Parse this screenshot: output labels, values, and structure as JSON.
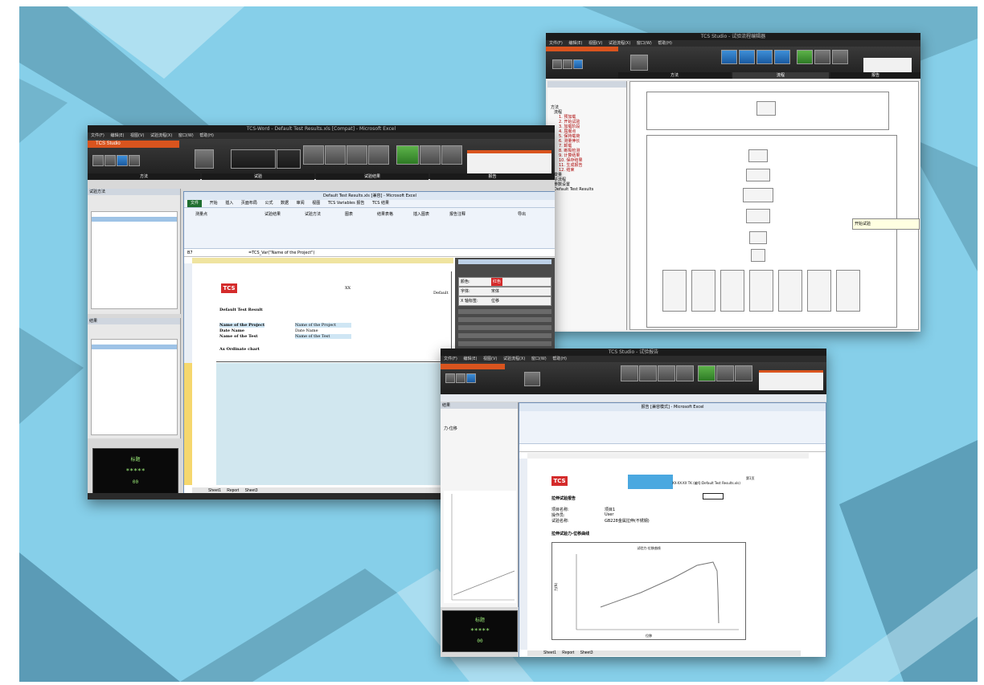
{
  "shot1": {
    "window_title": "TCS-Word - Default Test Results.xls [Compat] - Microsoft Excel",
    "menu": [
      "文件(F)",
      "编辑(E)",
      "视图(V)",
      "试验流程(X)",
      "窗口(W)",
      "帮助(H)"
    ],
    "app_label": "TCS Studio",
    "sections": [
      "方法",
      "试验",
      "试验结果",
      "报告"
    ],
    "excel_title": "Default Test Results.xls [兼容] - Microsoft Excel",
    "excel_tabs": [
      "文件",
      "开始",
      "插入",
      "页面布局",
      "公式",
      "数据",
      "审阅",
      "视图",
      "TCS Variables 报告",
      "TCS 结果"
    ],
    "ribbon_items": [
      "测量点",
      "试验结果",
      "试验方法",
      "图表",
      "结果表格",
      "插入图表",
      "报告注释",
      "导出"
    ],
    "name_box": "B7",
    "formula": "=TCS_Var(\"Name of the Project\")",
    "report": {
      "logo": "TCS",
      "center_label": "XX",
      "right_label": "Default",
      "heading": "Default Test Result",
      "rows": [
        [
          "Name of the Project",
          "Name of the Project"
        ],
        [
          "Date Name",
          "Date Name"
        ],
        [
          "Name of the Test",
          "Name of the Test"
        ]
      ],
      "subheading": "Ax Ordinate chart"
    },
    "props": [
      {
        "label": "颜色:",
        "value": "红色"
      },
      {
        "label": "字体:",
        "value": "宋体"
      },
      {
        "label": "X 轴标签:",
        "value": "位移"
      }
    ],
    "left_panel": {
      "top": "试验方法",
      "bottom": "结果"
    },
    "display": {
      "top": "标题",
      "value": "*****",
      "bottom": "00"
    },
    "sheet_tabs": [
      "Sheet1",
      "Report",
      "Sheet3"
    ]
  },
  "shot2": {
    "window_title": "TCS Studio - 试验流程编辑器",
    "menu": [
      "文件(F)",
      "编辑(E)",
      "视图(V)",
      "试验流程(X)",
      "窗口(W)",
      "帮助(H)"
    ],
    "sections": [
      "方法",
      "流程",
      "报告"
    ],
    "tree_items": [
      "方法",
      "流程",
      "1. 预加载",
      "2. 开始试验",
      "3. 加载阶段",
      "4. 屈服点",
      "5. 保持载荷",
      "6. 测量伸长",
      "7. 卸载",
      "8. 断裂检测",
      "9. 计算结果",
      "10. 保存结果",
      "11. 生成报告",
      "12. 结束",
      "变量",
      "子流程",
      "参数设置",
      "Default Test Results"
    ],
    "tooltip": "开始试验"
  },
  "shot3": {
    "window_title": "TCS Studio - 试验报告",
    "menu": [
      "文件(F)",
      "编辑(E)",
      "视图(V)",
      "试验流程(X)",
      "窗口(W)",
      "帮助(H)"
    ],
    "excel_title": "报告 [兼容模式] - Microsoft Excel",
    "report": {
      "logo": "TCS",
      "banner": "XX-XX-XX TK (编号:Default Test Results.xls)",
      "page": "第1页",
      "heading": "拉伸试验报告",
      "rows": [
        [
          "项目名称:",
          "项目1"
        ],
        [
          "操作员:",
          "User"
        ],
        [
          "试验名称:",
          "GB228金属拉伸(不锈钢)"
        ]
      ],
      "subheading": "拉伸试验力-位移曲线",
      "chart_title": "试验力-位移曲线",
      "ylabel": "力(N)",
      "xlabel": "位移"
    },
    "left_panel": {
      "top": "结果",
      "item": "力-位移"
    },
    "display": {
      "top": "标题",
      "value": "*****",
      "bottom": "00"
    },
    "sheet_tabs": [
      "Sheet1",
      "Report",
      "Sheet3"
    ]
  },
  "colors": {
    "background": "#86cfe9",
    "accent": "#d9541e",
    "dark": "#1e1e1e"
  }
}
